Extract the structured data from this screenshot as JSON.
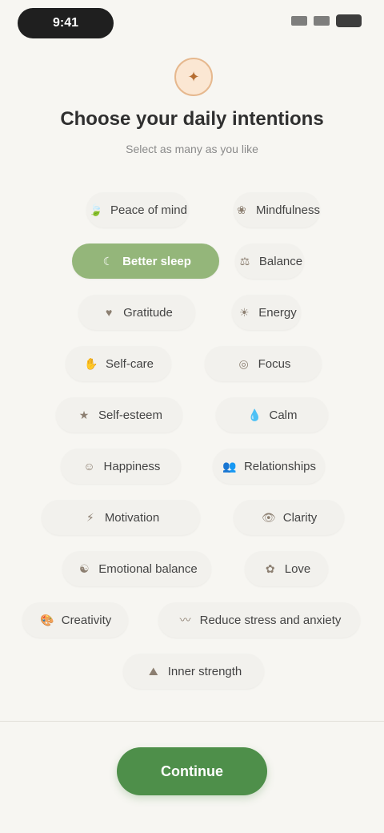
{
  "status_bar": {
    "time": "9:41"
  },
  "header": {
    "icon": "sparkle-icon",
    "title": "Choose your daily intentions",
    "subtitle": "Select as many as you like"
  },
  "chips": [
    {
      "label": "Peace of mind",
      "icon": "leaf-icon",
      "selected": false
    },
    {
      "label": "Mindfulness",
      "icon": "flower-icon",
      "selected": false
    },
    {
      "label": "Better sleep",
      "icon": "moon-icon",
      "selected": true
    },
    {
      "label": "Balance",
      "icon": "balance-icon",
      "selected": false
    },
    {
      "label": "Gratitude",
      "icon": "heart-icon",
      "selected": false
    },
    {
      "label": "Energy",
      "icon": "sun-icon",
      "selected": false
    },
    {
      "label": "Self-care",
      "icon": "hand-icon",
      "selected": false
    },
    {
      "label": "Focus",
      "icon": "target-icon",
      "selected": false
    },
    {
      "label": "Self-esteem",
      "icon": "star-icon",
      "selected": false
    },
    {
      "label": "Calm",
      "icon": "droplet-icon",
      "selected": false
    },
    {
      "label": "Happiness",
      "icon": "smile-icon",
      "selected": false
    },
    {
      "label": "Relationships",
      "icon": "people-icon",
      "selected": false
    },
    {
      "label": "Motivation",
      "icon": "bolt-icon",
      "selected": false
    },
    {
      "label": "Clarity",
      "icon": "eye-icon",
      "selected": false
    },
    {
      "label": "Emotional balance",
      "icon": "yin-yang-icon",
      "selected": false
    },
    {
      "label": "Love",
      "icon": "rose-icon",
      "selected": false
    },
    {
      "label": "Creativity",
      "icon": "palette-icon",
      "selected": false
    },
    {
      "label": "Reduce stress and anxiety",
      "icon": "wave-icon",
      "selected": false
    },
    {
      "label": "Inner strength",
      "icon": "mountain-icon",
      "selected": false
    }
  ],
  "footer": {
    "button_label": "Continue"
  }
}
